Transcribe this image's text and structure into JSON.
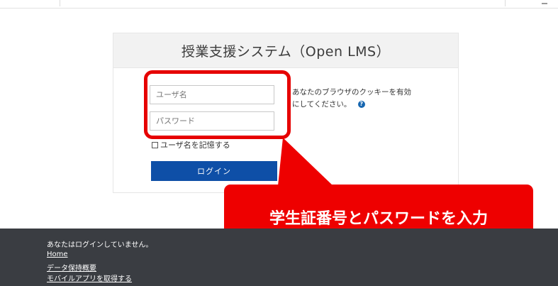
{
  "colors": {
    "accent_red": "#ee0000",
    "login_blue": "#0e4fa7",
    "footer_bg": "#3a3d42",
    "help_blue": "#1666b0"
  },
  "login": {
    "title": "授業支援システム（Open LMS）",
    "username_placeholder": "ユーザ名",
    "password_placeholder": "パスワード",
    "remember_label": "ユーザ名を記憶する",
    "login_button": "ログイン",
    "cookie_note_line1": "あなたのブラウザのクッキーを有効",
    "cookie_note_line2": "にしてください。",
    "help_icon": "question-circle-icon"
  },
  "callout": {
    "text": "学生証番号とパスワードを入力"
  },
  "footer": {
    "status": "あなたはログインしていません。",
    "links": [
      "Home",
      "データ保持概要",
      "モバイルアプリを取得する"
    ]
  }
}
